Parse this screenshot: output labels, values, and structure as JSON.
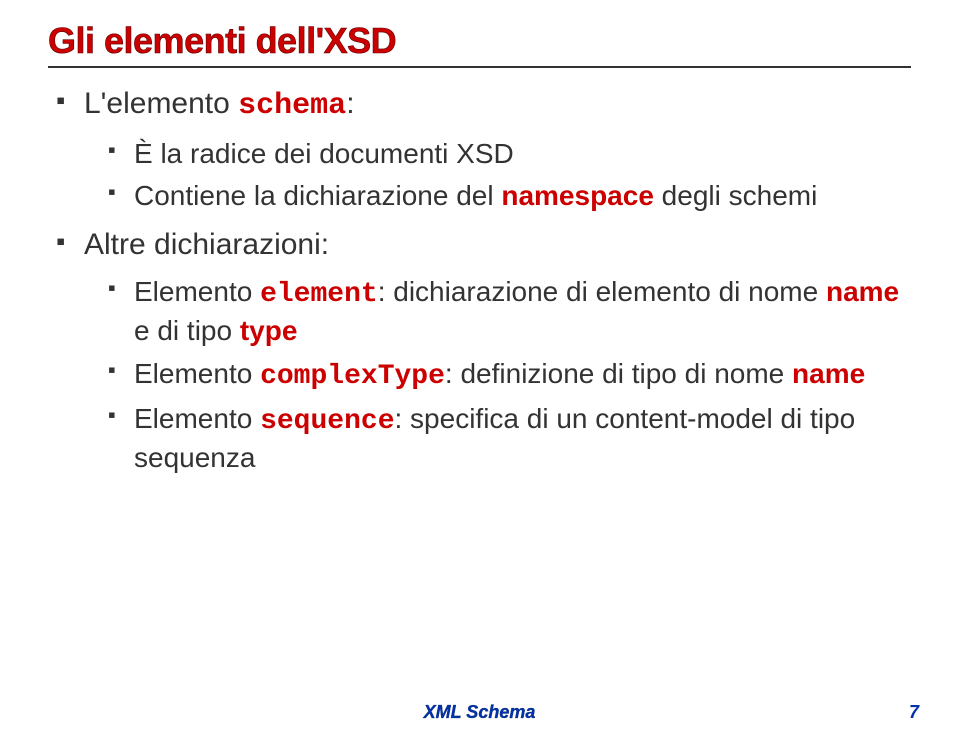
{
  "title": "Gli elementi dell'XSD",
  "bullets": {
    "item1": {
      "prefix": "L'elemento ",
      "code": "schema",
      "suffix": ":",
      "sub": {
        "a": "È la radice dei documenti XSD",
        "b_prefix": "Contiene la dichiarazione del ",
        "b_kw": "namespace",
        "b_suffix": " degli schemi"
      }
    },
    "item2": {
      "text": "Altre dichiarazioni:",
      "sub": {
        "a_prefix": "Elemento ",
        "a_code": "element",
        "a_mid": ": dichiarazione di elemento di nome ",
        "a_kw1": "name",
        "a_mid2": " e di tipo ",
        "a_kw2": "type",
        "b_prefix": "Elemento ",
        "b_code": "complexType",
        "b_mid": ": definizione di tipo di nome ",
        "b_kw": "name",
        "c_prefix": "Elemento ",
        "c_code": "sequence",
        "c_suffix": ": specifica di un content-model di tipo sequenza"
      }
    }
  },
  "footer": "XML Schema",
  "page": "7"
}
